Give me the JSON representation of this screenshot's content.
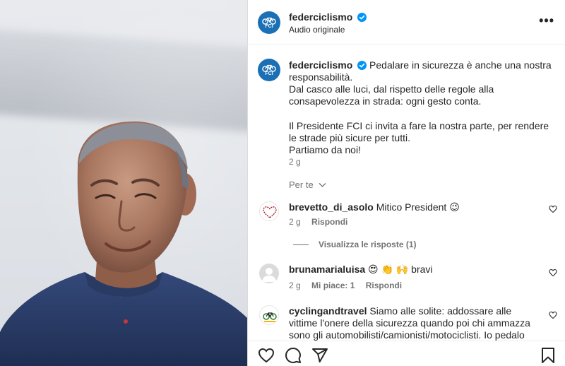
{
  "header": {
    "username": "federciclismo",
    "subtitle": "Audio originale",
    "avatar_text": "FCI",
    "more_label": "•••"
  },
  "caption": {
    "username": "federciclismo",
    "line1": "Pedalare in sicurezza è anche una nostra responsabilità.",
    "line2": "Dal casco alle luci, dal rispetto delle regole alla consapevolezza in strada: ogni gesto conta.",
    "line3": "Il Presidente FCI ci invita a fare la nostra parte, per rendere le strade più sicure per tutti.",
    "line4": "Partiamo da noi!",
    "time": "2 g",
    "translate": "Per te"
  },
  "comments": [
    {
      "username": "brevetto_di_asolo",
      "text": "Mitico President 😉",
      "time": "2 g",
      "reply": "Rispondi",
      "view_replies": "Visualizza le risposte (1)"
    },
    {
      "username": "brunamarialuisa",
      "text": "😍 👏 🙌 bravi",
      "time": "2 g",
      "likes": "Mi piace: 1",
      "reply": "Rispondi"
    },
    {
      "username": "cyclingandtravel",
      "text": "Siamo alle solite: addossare alle vittime l'onere della sicurezza quando poi chi ammazza sono gli automobilisti/camionisti/motociclisti. Io pedalo quasi sempre"
    }
  ],
  "colors": {
    "accent": "#1a6fb5",
    "verified": "#0095f6",
    "text": "#262626",
    "muted": "#737373",
    "shirt": "#2b3f66"
  },
  "icons": {
    "like": "heart-icon",
    "comment": "comment-icon",
    "share": "send-icon",
    "save": "bookmark-icon"
  }
}
